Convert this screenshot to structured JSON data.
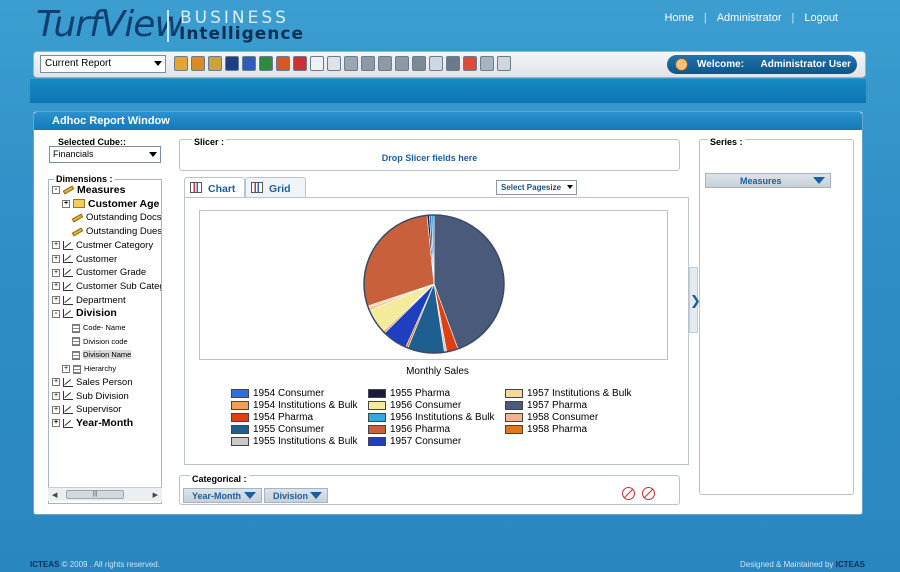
{
  "header": {
    "logo_main": "TurfView",
    "logo_business": "BUSINESS",
    "logo_intelligence": "Intelligence",
    "links": [
      "Home",
      "Administrator",
      "Logout"
    ]
  },
  "toolbar": {
    "report_select": "Current Report",
    "welcome_label": "Welcome:",
    "welcome_user": "Administrator User"
  },
  "window": {
    "title": "Adhoc Report Window",
    "cube_label": "Selected Cube::",
    "cube_value": "Financials",
    "dimensions_label": "Dimensions :",
    "slicer_label": "Slicer :",
    "slicer_drop": "Drop Slicer fields here",
    "tabs": [
      "Chart",
      "Grid"
    ],
    "pagesize": "Select Pagesize",
    "categorical_label": "Categorical :",
    "categorical_fields": [
      "Year-Month",
      "Division"
    ],
    "series_label": "Series :",
    "series_fields": [
      "Measures"
    ]
  },
  "tree": [
    {
      "label": "Measures",
      "type": "measures",
      "pm": "-",
      "bold": true
    },
    {
      "label": "Customer Age",
      "type": "folder",
      "pm": "+",
      "bold": true
    },
    {
      "label": "Outstanding Docs",
      "type": "ruler"
    },
    {
      "label": "Outstanding Dues",
      "type": "ruler"
    },
    {
      "label": "Custmer Category",
      "type": "dim",
      "pm": "+"
    },
    {
      "label": "Customer",
      "type": "dim",
      "pm": "+"
    },
    {
      "label": "Customer Grade",
      "type": "dim",
      "pm": "+"
    },
    {
      "label": "Customer Sub Category",
      "type": "dim",
      "pm": "+"
    },
    {
      "label": "Department",
      "type": "dim",
      "pm": "+"
    },
    {
      "label": "Division",
      "type": "dim",
      "pm": "-",
      "bold": true
    },
    {
      "label": "Code- Name",
      "type": "level"
    },
    {
      "label": "Division code",
      "type": "level"
    },
    {
      "label": "Division Name",
      "type": "level",
      "selected": true
    },
    {
      "label": "Hierarchy",
      "type": "level",
      "pm": "+"
    },
    {
      "label": "Sales Person",
      "type": "dim",
      "pm": "+"
    },
    {
      "label": "Sub Division",
      "type": "dim",
      "pm": "+"
    },
    {
      "label": "Supervisor",
      "type": "dim",
      "pm": "+"
    },
    {
      "label": "Year-Month",
      "type": "dim",
      "pm": "+",
      "bold": true
    }
  ],
  "chart_data": {
    "type": "pie",
    "title": "Monthly Sales",
    "series": [
      {
        "name": "1954 Consumer",
        "value": 0.5,
        "color": "#2f6fd0"
      },
      {
        "name": "1954 Institutions & Bulk",
        "value": 0.5,
        "color": "#f0a050"
      },
      {
        "name": "1954 Pharma",
        "value": 2.5,
        "color": "#e04010"
      },
      {
        "name": "1955 Consumer",
        "value": 8.0,
        "color": "#1f5f8f"
      },
      {
        "name": "1955 Institutions & Bulk",
        "value": 0.5,
        "color": "#c7c9cb"
      },
      {
        "name": "1955 Pharma",
        "value": 0.5,
        "color": "#1a1a3f"
      },
      {
        "name": "1956 Consumer",
        "value": 5.5,
        "color": "#f4ec9c"
      },
      {
        "name": "1956 Institutions & Bulk",
        "value": 0.5,
        "color": "#30a8e0"
      },
      {
        "name": "1956 Pharma",
        "value": 27.0,
        "color": "#c8603c"
      },
      {
        "name": "1957 Consumer",
        "value": 5.5,
        "color": "#1e40c0"
      },
      {
        "name": "1957 Institutions & Bulk",
        "value": 0.5,
        "color": "#f7d79a"
      },
      {
        "name": "1957 Pharma",
        "value": 42.0,
        "color": "#4a5a7a"
      },
      {
        "name": "1958 Consumer",
        "value": 0.5,
        "color": "#f3b58b"
      },
      {
        "name": "1958 Pharma",
        "value": 0.5,
        "color": "#e0781c"
      }
    ],
    "legend_position": "bottom"
  },
  "footer": {
    "brand_left": "ICTEAS",
    "copyright": "© 2009 . All rights reserved.",
    "maintained": "Designed & Maintained by",
    "brand_right": "ICTEAS"
  }
}
